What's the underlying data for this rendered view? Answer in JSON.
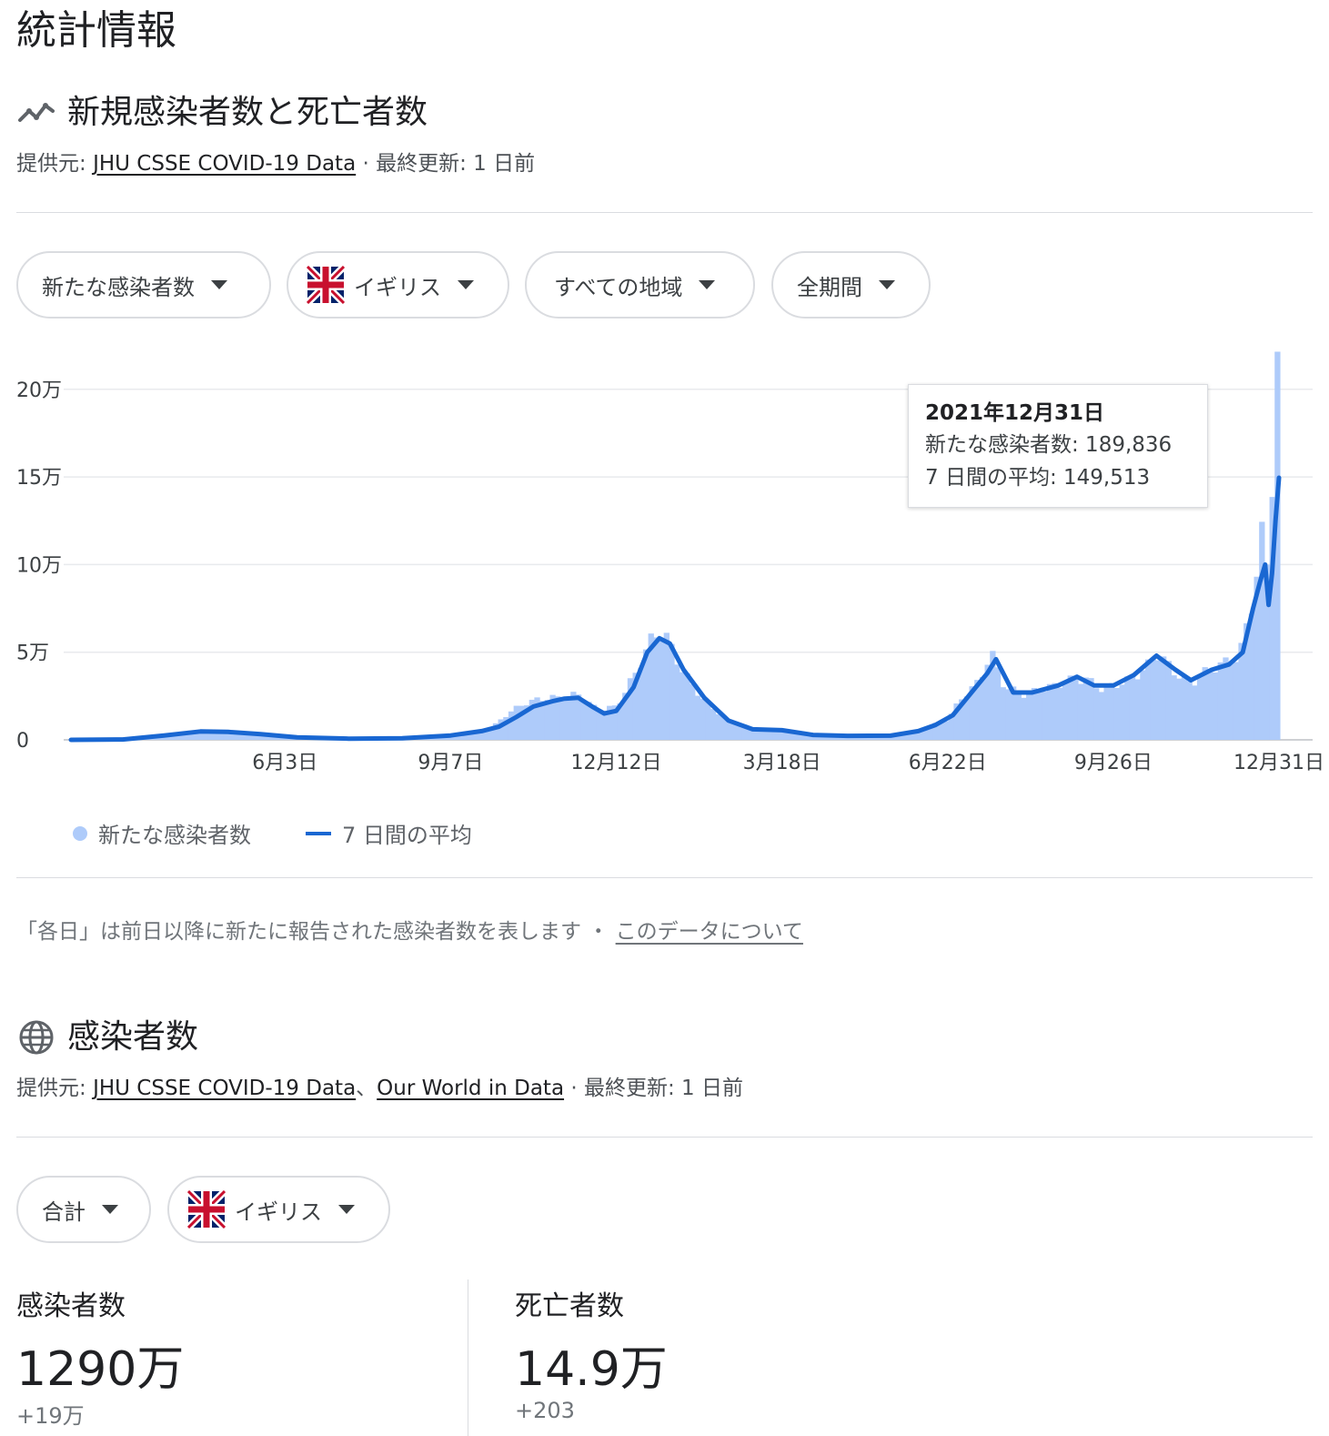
{
  "page_title": "統計情報",
  "section1": {
    "title": "新規感染者数と死亡者数",
    "source_prefix": "提供元: ",
    "source_link": "JHU CSSE COVID-19 Data",
    "updated": " · 最終更新: 1 日前"
  },
  "filters": [
    {
      "label": "新たな感染者数"
    },
    {
      "label": "イギリス",
      "flag": "uk-flag-icon"
    },
    {
      "label": "すべての地域"
    },
    {
      "label": "全期間"
    }
  ],
  "tooltip": {
    "date": "2021年12月31日",
    "row1": "新たな感染者数: 189,836",
    "row2": "7 日間の平均: 149,513"
  },
  "legend": {
    "series1": "新たな感染者数",
    "series2": "7 日間の平均"
  },
  "note": {
    "text": "「各日」は前日以降に新たに報告された感染者数を表します ・ ",
    "link": "このデータについて"
  },
  "section2": {
    "title": "感染者数",
    "source_prefix": "提供元: ",
    "source_link1": "JHU CSSE COVID-19 Data",
    "sep": "、",
    "source_link2": "Our World in Data",
    "updated": " · 最終更新: 1 日前"
  },
  "filters2": [
    {
      "label": "合計"
    },
    {
      "label": "イギリス",
      "flag": "uk-flag-icon"
    }
  ],
  "stats": [
    {
      "label": "感染者数",
      "value": "1290万",
      "delta": "+19万"
    },
    {
      "label": "死亡者数",
      "value": "14.9万",
      "delta": "+203"
    }
  ],
  "colors": {
    "bars": "#aecbfa",
    "line": "#1967d2",
    "grid": "#e8eaed"
  },
  "chart_data": {
    "type": "bar",
    "title": "",
    "xlabel": "",
    "ylabel": "",
    "ylim": [
      0,
      230000
    ],
    "y_ticks": [
      0,
      50000,
      100000,
      150000,
      200000
    ],
    "y_tick_labels": [
      "0",
      "5万",
      "10万",
      "15万",
      "20万"
    ],
    "x_ticks": [
      "2020-06-03",
      "2020-09-07",
      "2020-12-12",
      "2021-03-18",
      "2021-06-22",
      "2021-09-26",
      "2021-12-31"
    ],
    "x_tick_labels": [
      "6月3日",
      "9月7日",
      "12月12日",
      "3月18日",
      "6月22日",
      "9月26日",
      "12月31日"
    ],
    "x_range": [
      "2020-01-31",
      "2021-12-31"
    ],
    "series": [
      {
        "name": "新たな感染者数",
        "kind": "bar",
        "points": [
          [
            "2020-01-31",
            0
          ],
          [
            "2020-02-29",
            200
          ],
          [
            "2020-03-20",
            2000
          ],
          [
            "2020-04-10",
            5000
          ],
          [
            "2020-04-25",
            5500
          ],
          [
            "2020-05-10",
            4000
          ],
          [
            "2020-05-25",
            2500
          ],
          [
            "2020-06-10",
            1500
          ],
          [
            "2020-07-01",
            800
          ],
          [
            "2020-07-20",
            600
          ],
          [
            "2020-08-10",
            1000
          ],
          [
            "2020-08-25",
            1200
          ],
          [
            "2020-09-07",
            2500
          ],
          [
            "2020-09-20",
            4500
          ],
          [
            "2020-10-01",
            7000
          ],
          [
            "2020-10-10",
            15000
          ],
          [
            "2020-10-20",
            21000
          ],
          [
            "2020-11-01",
            24000
          ],
          [
            "2020-11-10",
            24000
          ],
          [
            "2020-11-20",
            26000
          ],
          [
            "2020-12-01",
            17000
          ],
          [
            "2020-12-12",
            19000
          ],
          [
            "2020-12-22",
            36000
          ],
          [
            "2020-12-31",
            55000
          ],
          [
            "2021-01-05",
            62000
          ],
          [
            "2021-01-10",
            58000
          ],
          [
            "2021-01-20",
            38000
          ],
          [
            "2021-02-01",
            22000
          ],
          [
            "2021-02-15",
            11000
          ],
          [
            "2021-03-01",
            6500
          ],
          [
            "2021-03-18",
            5500
          ],
          [
            "2021-04-05",
            3000
          ],
          [
            "2021-04-25",
            2200
          ],
          [
            "2021-05-15",
            2300
          ],
          [
            "2021-06-01",
            4000
          ],
          [
            "2021-06-10",
            7000
          ],
          [
            "2021-06-22",
            12000
          ],
          [
            "2021-07-01",
            25000
          ],
          [
            "2021-07-10",
            33000
          ],
          [
            "2021-07-17",
            50000
          ],
          [
            "2021-07-25",
            30000
          ],
          [
            "2021-08-05",
            26000
          ],
          [
            "2021-08-20",
            30000
          ],
          [
            "2021-09-01",
            34000
          ],
          [
            "2021-09-10",
            35000
          ],
          [
            "2021-09-18",
            29000
          ],
          [
            "2021-09-26",
            31000
          ],
          [
            "2021-10-05",
            34000
          ],
          [
            "2021-10-15",
            41000
          ],
          [
            "2021-10-21",
            50000
          ],
          [
            "2021-11-01",
            38000
          ],
          [
            "2021-11-10",
            32000
          ],
          [
            "2021-11-20",
            40000
          ],
          [
            "2021-11-30",
            44000
          ],
          [
            "2021-12-08",
            48000
          ],
          [
            "2021-12-14",
            72000
          ],
          [
            "2021-12-18",
            95000
          ],
          [
            "2021-12-22",
            122000
          ],
          [
            "2021-12-24",
            100000
          ],
          [
            "2021-12-26",
            76000
          ],
          [
            "2021-12-28",
            225000
          ],
          [
            "2021-12-30",
            217000
          ],
          [
            "2021-12-31",
            189836
          ]
        ]
      },
      {
        "name": "7 日間の平均",
        "kind": "line",
        "points": [
          [
            "2020-01-31",
            0
          ],
          [
            "2020-03-01",
            200
          ],
          [
            "2020-03-25",
            2500
          ],
          [
            "2020-04-15",
            4800
          ],
          [
            "2020-05-01",
            4500
          ],
          [
            "2020-05-20",
            3200
          ],
          [
            "2020-06-10",
            1400
          ],
          [
            "2020-07-10",
            700
          ],
          [
            "2020-08-10",
            900
          ],
          [
            "2020-09-07",
            2500
          ],
          [
            "2020-09-25",
            5000
          ],
          [
            "2020-10-05",
            7500
          ],
          [
            "2020-10-15",
            13000
          ],
          [
            "2020-10-25",
            19000
          ],
          [
            "2020-11-05",
            22000
          ],
          [
            "2020-11-12",
            23500
          ],
          [
            "2020-11-20",
            24000
          ],
          [
            "2020-11-28",
            19000
          ],
          [
            "2020-12-05",
            15000
          ],
          [
            "2020-12-12",
            16500
          ],
          [
            "2020-12-22",
            30000
          ],
          [
            "2020-12-30",
            50000
          ],
          [
            "2021-01-06",
            58000
          ],
          [
            "2021-01-12",
            55000
          ],
          [
            "2021-01-20",
            40000
          ],
          [
            "2021-02-01",
            24000
          ],
          [
            "2021-02-15",
            11000
          ],
          [
            "2021-03-01",
            6000
          ],
          [
            "2021-03-18",
            5500
          ],
          [
            "2021-04-05",
            2800
          ],
          [
            "2021-04-25",
            2300
          ],
          [
            "2021-05-20",
            2400
          ],
          [
            "2021-06-05",
            5000
          ],
          [
            "2021-06-15",
            8500
          ],
          [
            "2021-06-25",
            14000
          ],
          [
            "2021-07-05",
            26000
          ],
          [
            "2021-07-15",
            38000
          ],
          [
            "2021-07-20",
            46000
          ],
          [
            "2021-07-30",
            27000
          ],
          [
            "2021-08-10",
            27000
          ],
          [
            "2021-08-25",
            31000
          ],
          [
            "2021-09-05",
            36000
          ],
          [
            "2021-09-15",
            31000
          ],
          [
            "2021-09-26",
            31000
          ],
          [
            "2021-10-08",
            37000
          ],
          [
            "2021-10-21",
            48000
          ],
          [
            "2021-11-01",
            40000
          ],
          [
            "2021-11-10",
            34000
          ],
          [
            "2021-11-22",
            40000
          ],
          [
            "2021-12-02",
            43000
          ],
          [
            "2021-12-10",
            50000
          ],
          [
            "2021-12-16",
            75000
          ],
          [
            "2021-12-20",
            90000
          ],
          [
            "2021-12-23",
            100000
          ],
          [
            "2021-12-25",
            77000
          ],
          [
            "2021-12-27",
            95000
          ],
          [
            "2021-12-29",
            125000
          ],
          [
            "2021-12-31",
            149513
          ]
        ]
      }
    ]
  }
}
